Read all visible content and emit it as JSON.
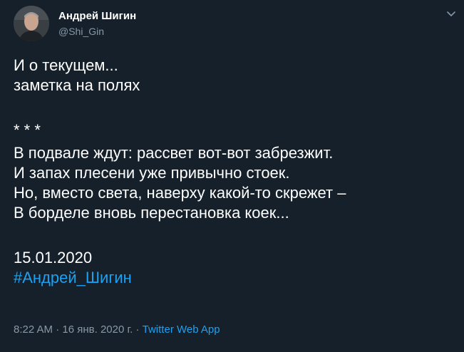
{
  "author": {
    "name": "Андрей Шигин",
    "handle": "@Shi_Gin",
    "avatar_icon": "profile-photo"
  },
  "menu_icon": "chevron-down-icon",
  "tweet": {
    "intro": [
      "И о текущем...",
      "заметка на полях"
    ],
    "separator": "* * *",
    "poem": [
      "В подвале ждут: рассвет вот-вот забрезжит.",
      "И запах плесени уже привычно стоек.",
      "Но, вместо света, наверху какой-то скрежет –",
      "В борделе вновь перестановка коек..."
    ],
    "date": "15.01.2020",
    "hashtag": "#Андрей_Шигин"
  },
  "meta": {
    "time": "8:22 AM",
    "separator1": " · ",
    "date": "16 янв. 2020 г.",
    "separator2": " · ",
    "source": "Twitter Web App"
  },
  "colors": {
    "background": "#15202b",
    "text": "#ffffff",
    "secondary": "#8899a6",
    "link": "#1da1f2"
  }
}
